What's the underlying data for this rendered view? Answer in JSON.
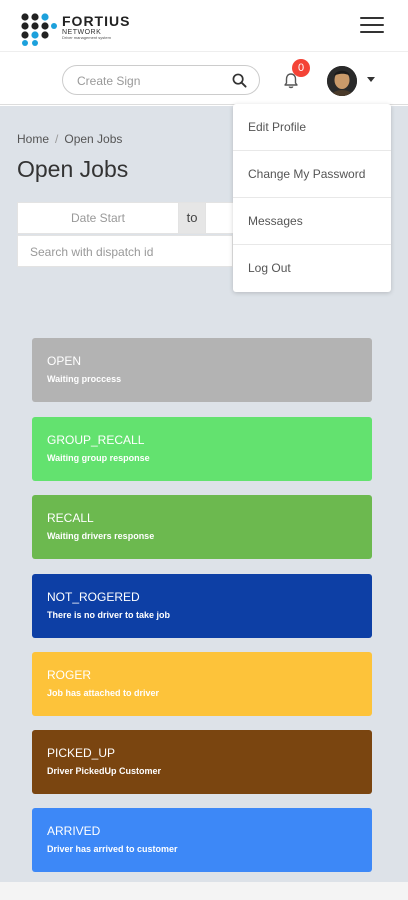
{
  "brand": {
    "name": "FORTIUS",
    "sub": "NETWORK",
    "tagline": "Driver management system"
  },
  "header": {
    "search_placeholder": "Create Sign",
    "notification_count": "0"
  },
  "user_menu": {
    "items": [
      "Edit Profile",
      "Change My Password",
      "Messages",
      "Log Out"
    ]
  },
  "breadcrumb": {
    "home": "Home",
    "current": "Open Jobs"
  },
  "page": {
    "title": "Open Jobs"
  },
  "filters": {
    "date_start_placeholder": "Date Start",
    "to_label": "to",
    "dispatch_placeholder": "Search with dispatch id"
  },
  "statuses": [
    {
      "title": "OPEN",
      "desc": "Waiting proccess",
      "color": "#b3b3b3"
    },
    {
      "title": "GROUP_RECALL",
      "desc": "Waiting group response",
      "color": "#63e26f"
    },
    {
      "title": "RECALL",
      "desc": "Waiting drivers response",
      "color": "#6cb94f"
    },
    {
      "title": "NOT_ROGERED",
      "desc": "There is no driver to take job",
      "color": "#0d3fa5"
    },
    {
      "title": "ROGER",
      "desc": "Job has attached to driver",
      "color": "#fdc33a"
    },
    {
      "title": "PICKED_UP",
      "desc": "Driver PickedUp Customer",
      "color": "#7a4510"
    },
    {
      "title": "ARRIVED",
      "desc": "Driver has arrived to customer",
      "color": "#3d88f7"
    }
  ],
  "icons": {
    "menu": "hamburger-icon",
    "search": "search-icon",
    "notifications": "bell-icon",
    "user": "avatar",
    "dropdown": "chevron-down-icon"
  }
}
